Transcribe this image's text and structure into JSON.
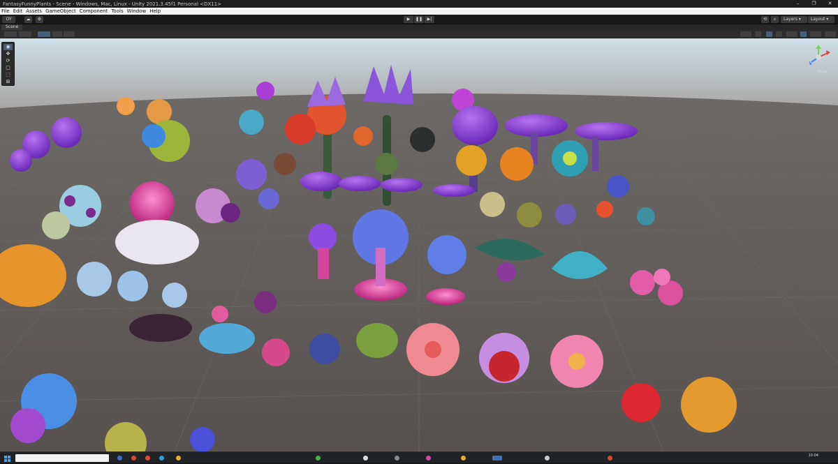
{
  "window": {
    "title": "FantasyFunnyPlants - Scene - Windows, Mac, Linux - Unity 2021.3.45f1 Personal <DX11>",
    "minimize": "–",
    "maximize": "❐",
    "close": "✕"
  },
  "menu": [
    "File",
    "Edit",
    "Assets",
    "GameObject",
    "Component",
    "Tools",
    "Window",
    "Help"
  ],
  "toolbar": {
    "account": "OY",
    "play_icon": "▶",
    "pause_icon": "❚❚",
    "step_icon": "▶|",
    "layers_label": "Layers",
    "layout_label": "Layout"
  },
  "scene_tab": {
    "label": "Scene"
  },
  "gizmo": {
    "label": "Persp"
  },
  "tools": [
    "eye-icon",
    "move-icon",
    "rotate-icon",
    "scale-icon",
    "rect-icon",
    "transform-icon"
  ],
  "taskbar": {
    "clock_time": "10:04",
    "clock_date": ""
  },
  "colors": {
    "viewport_ground": "#5f5a57",
    "sky_top": "#c9dde9",
    "accent_blue": "#46607c",
    "purple_plant": "#8b3fd0",
    "pink_plant": "#e25fa3",
    "orange_plant": "#e07a2c",
    "teal_plant": "#3ea5b6"
  }
}
